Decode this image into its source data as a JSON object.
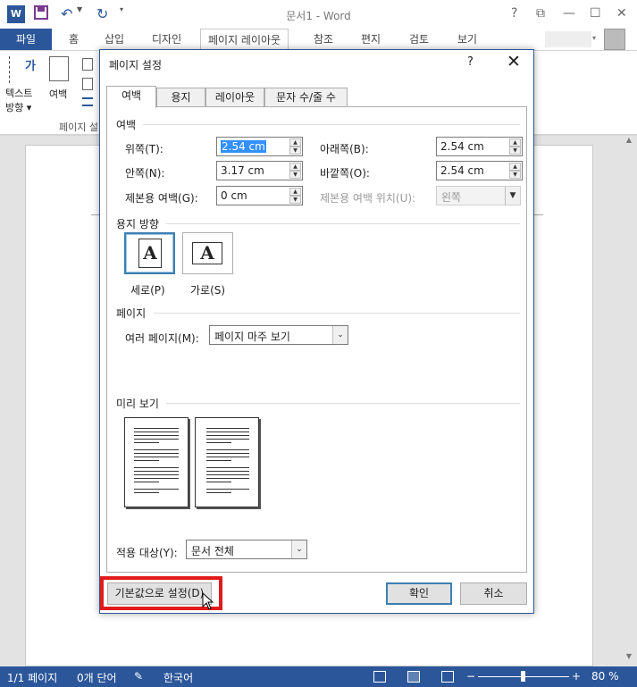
{
  "window": {
    "title": "문서1 - Word",
    "word_logo": "W",
    "help": "?",
    "restore": "⧉",
    "minimize": "—",
    "maximize": "☐",
    "close": "✕"
  },
  "ribbon": {
    "tabs": [
      "파일",
      "홈",
      "삽입",
      "디자인",
      "페이지 레이아웃",
      "참조",
      "편지",
      "검토",
      "보기"
    ],
    "active_tab": "페이지 레이아웃",
    "text_direction_glyph": "가",
    "text_direction_line1": "텍스트",
    "text_direction_line2": "방향 ▾",
    "margins_label": "여백",
    "group_label": "페이지 설"
  },
  "status": {
    "page": "1/1 페이지",
    "words": "0개 단어",
    "language": "한국어",
    "zoom": "80 %",
    "zoom_level_percent": 80
  },
  "dialog": {
    "title": "페이지 설정",
    "help": "?",
    "close": "✕",
    "tabs": [
      "여백",
      "용지",
      "레이아웃",
      "문자 수/줄 수"
    ],
    "active_tab": "여백",
    "margins": {
      "section": "여백",
      "top_label": "위쪽(T):",
      "top_value": "2.54 cm",
      "bottom_label": "아래쪽(B):",
      "bottom_value": "2.54 cm",
      "inside_label": "안쪽(N):",
      "inside_value": "3.17 cm",
      "outside_label": "바깥쪽(O):",
      "outside_value": "2.54 cm",
      "gutter_label": "제본용 여백(G):",
      "gutter_value": "0 cm",
      "gutter_pos_label": "제본용 여백 위치(U):",
      "gutter_pos_value": "왼쪽"
    },
    "orientation": {
      "section": "용지 방향",
      "portrait": "세로(P)",
      "landscape": "가로(S)",
      "glyph": "A",
      "selected": "portrait"
    },
    "pages": {
      "section": "페이지",
      "multiple_label": "여러 페이지(M):",
      "multiple_value": "페이지 마주 보기"
    },
    "preview": {
      "section": "미리 보기"
    },
    "apply": {
      "label": "적용 대상(Y):",
      "value": "문서 전체"
    },
    "buttons": {
      "default": "기본값으로 설정(D)",
      "ok": "확인",
      "cancel": "취소"
    }
  },
  "colors": {
    "accent": "#2b579a",
    "highlight": "#e11b1b",
    "selection": "#3390ff"
  }
}
